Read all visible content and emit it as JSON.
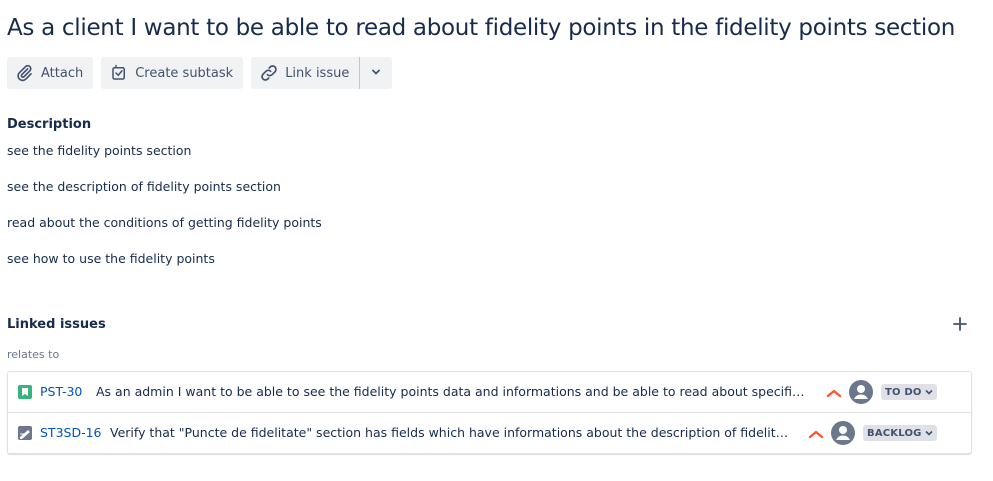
{
  "issue": {
    "title": "As a client I want to be able to read about fidelity points in the fidelity points section"
  },
  "toolbar": {
    "attach_label": "Attach",
    "create_subtask_label": "Create subtask",
    "link_issue_label": "Link issue"
  },
  "description": {
    "heading": "Description",
    "lines": [
      "see the fidelity points section",
      "see the description of fidelity points section",
      "read about the conditions of getting fidelity points",
      "see how to use the fidelity points"
    ]
  },
  "linked_issues": {
    "heading": "Linked issues",
    "relation": "relates to",
    "items": [
      {
        "type_icon": "story-icon",
        "key": "PST-30",
        "summary": "As an admin I want to be able to see the fidelity points data and informations and be able to read about specific el...",
        "priority_icon": "priority-high-icon",
        "status": "TO DO"
      },
      {
        "type_icon": "test-icon",
        "key": "ST3SD-16",
        "summary": "Verify that \"Puncte de fidelitate\" section has fields which have informations about the description of fidelity po...",
        "priority_icon": "priority-high-icon",
        "status": "BACKLOG"
      }
    ]
  },
  "colors": {
    "text": "#172b4d",
    "link": "#0052cc",
    "button_bg": "#f1f2f4",
    "priority": "#ff5630",
    "story": "#36b37e"
  }
}
